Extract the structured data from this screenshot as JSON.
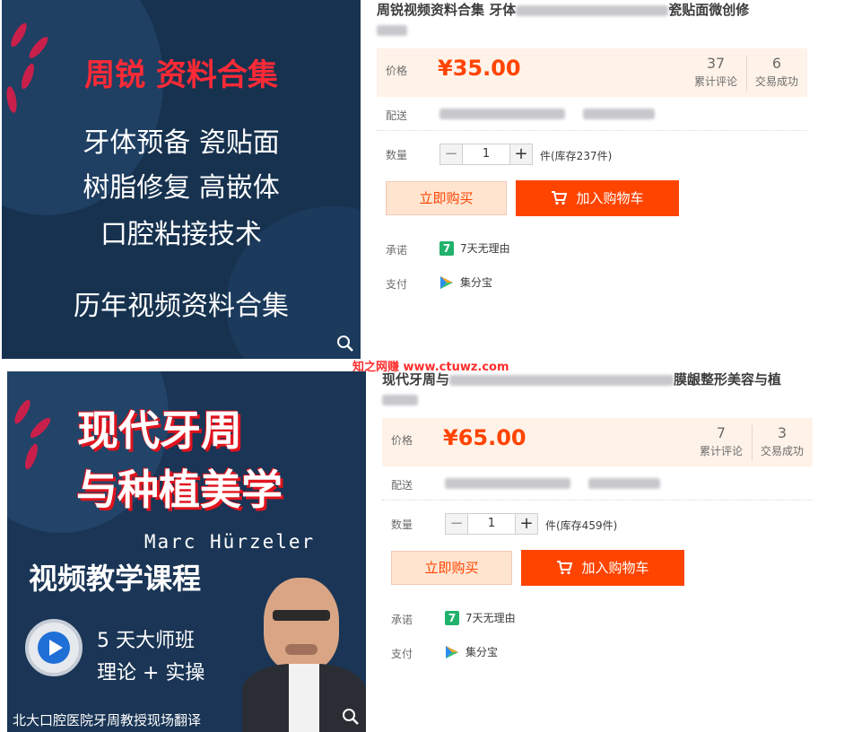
{
  "listings": [
    {
      "image": {
        "line1": "周锐  资料合集",
        "line2": "牙体预备   瓷贴面",
        "line3": "树脂修复   高嵌体",
        "line4": "口腔粘接技术",
        "line5": "历年视频资料合集"
      },
      "title_start": "周锐视频资料合集 牙体",
      "title_end": "瓷贴面微创修",
      "price_label": "价格",
      "price": "¥35.00",
      "reviews_count": "37",
      "reviews_label": "累计评论",
      "trades_count": "6",
      "trades_label": "交易成功",
      "shipping_label": "配送",
      "quantity_label": "数量",
      "quantity": "1",
      "stock": "件(库存237件)",
      "buy_now": "立即购买",
      "add_to_cart": "加入购物车",
      "promise_label": "承诺",
      "promise_badge": "7",
      "promise_text": "7天无理由",
      "pay_label": "支付",
      "pay_text": "集分宝"
    },
    {
      "image": {
        "line1": "现代牙周",
        "line2": "与种植美学",
        "speaker": "Marc Hürzeler",
        "line3": "视频教学课程",
        "line4": "5 天大师班",
        "line5": "理论 + 实操",
        "footer": "北大口腔医院牙周教授现场翻译"
      },
      "title_start": "现代牙周与",
      "title_end": "膜龈整形美容与植",
      "price_label": "价格",
      "price": "¥65.00",
      "reviews_count": "7",
      "reviews_label": "累计评论",
      "trades_count": "3",
      "trades_label": "交易成功",
      "shipping_label": "配送",
      "quantity_label": "数量",
      "quantity": "1",
      "stock": "件(库存459件)",
      "buy_now": "立即购买",
      "add_to_cart": "加入购物车",
      "promise_label": "承诺",
      "promise_badge": "7",
      "promise_text": "7天无理由",
      "pay_label": "支付",
      "pay_text": "集分宝"
    }
  ],
  "watermark": "知之网赚 www.ctuwz.com",
  "colors": {
    "price": "#ff4400",
    "price_bg": "#fff2e8",
    "cart_button": "#ff4400",
    "buy_button_bg": "#ffe4d0",
    "image_bg": "#16324f",
    "image_title_red": "#ff2a36"
  }
}
